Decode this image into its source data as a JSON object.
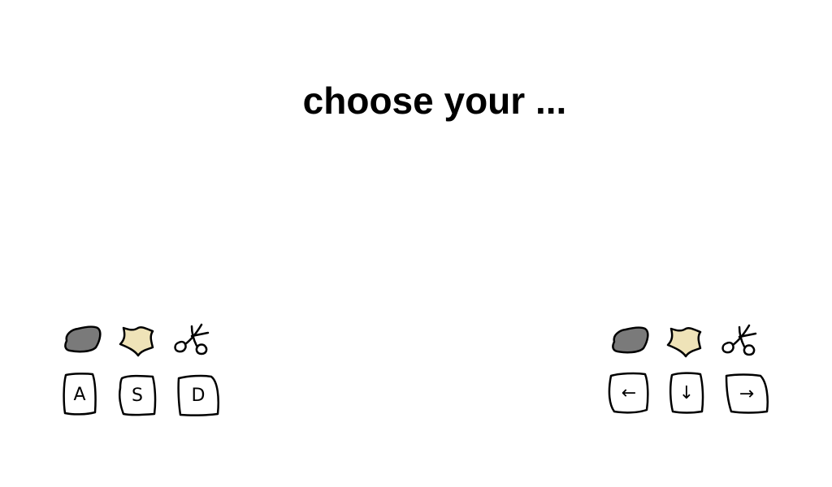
{
  "screen": {
    "title": "choose your ..."
  },
  "choices": [
    {
      "name": "rock",
      "icon": "rock-icon",
      "color": "#7a7a7a"
    },
    {
      "name": "paper",
      "icon": "paper-icon",
      "color": "#efe3b8"
    },
    {
      "name": "scissors",
      "icon": "scissors-icon",
      "color": "#ffffff"
    }
  ],
  "players": {
    "left": {
      "keys": [
        "A",
        "S",
        "D"
      ]
    },
    "right": {
      "keys": [
        "←",
        "↓",
        "→"
      ]
    }
  },
  "colors": {
    "outline": "#000000",
    "background": "#ffffff"
  }
}
